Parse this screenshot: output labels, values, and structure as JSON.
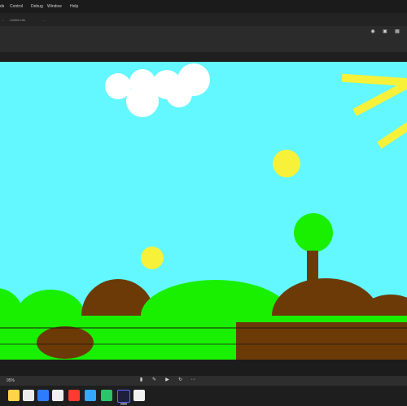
{
  "menu": {
    "items": [
      "ds",
      "Control",
      "Debug",
      "Window",
      "Help"
    ]
  },
  "tabs": {
    "items": [
      "...",
      "Untitled.fla",
      "..."
    ]
  },
  "controls": {
    "zoom": "95%"
  },
  "colors": {
    "sky": "#63f7ff",
    "grass": "#19f000",
    "soil": "#6c3a06",
    "sun": "#f7f13a",
    "cloud": "#ffffff",
    "ui_dark": "#1b1b1b"
  },
  "icons": {
    "toolbar": [
      "snapshot-icon",
      "layers-icon",
      "grid-icon"
    ],
    "controls": [
      "frame-icon",
      "edit-icon",
      "play-icon",
      "loop-icon",
      "more-icon"
    ],
    "taskbar": [
      "windows-icon",
      "search-icon",
      "edge-icon",
      "files-icon",
      "chrome-icon",
      "store-icon",
      "photoshop-icon",
      "animate-icon",
      "notes-icon"
    ]
  }
}
